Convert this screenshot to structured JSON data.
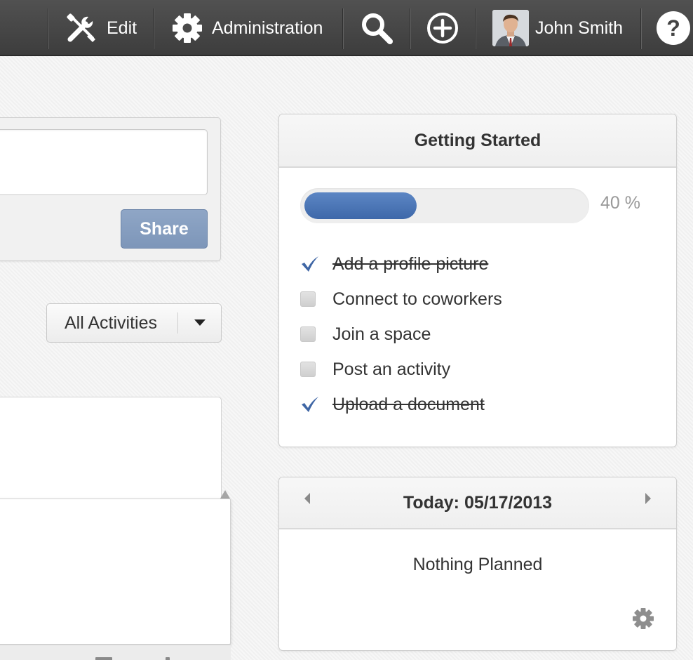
{
  "topbar": {
    "edit_label": "Edit",
    "admin_label": "Administration",
    "user_name": "John Smith",
    "icons": [
      "tools-icon",
      "gear-icon",
      "search-icon",
      "add-circle-icon",
      "avatar",
      "help-icon"
    ],
    "help_glyph": "?"
  },
  "share": {
    "input_value": "",
    "button_label": "Share"
  },
  "filter": {
    "selected": "All Activities"
  },
  "getting_started": {
    "title": "Getting Started",
    "progress_percent": 40,
    "progress_label": "40 %",
    "tasks": [
      {
        "label": "Add a profile picture",
        "done": true
      },
      {
        "label": "Connect to coworkers",
        "done": false
      },
      {
        "label": "Join a space",
        "done": false
      },
      {
        "label": "Post an activity",
        "done": false
      },
      {
        "label": "Upload a document",
        "done": true
      }
    ]
  },
  "calendar": {
    "title": "Today: 05/17/2013",
    "empty_text": "Nothing Planned"
  },
  "colors": {
    "topbar": "#474747",
    "accent": "#4a72b0",
    "share_button": "#8299bc",
    "muted_text": "#999999"
  }
}
